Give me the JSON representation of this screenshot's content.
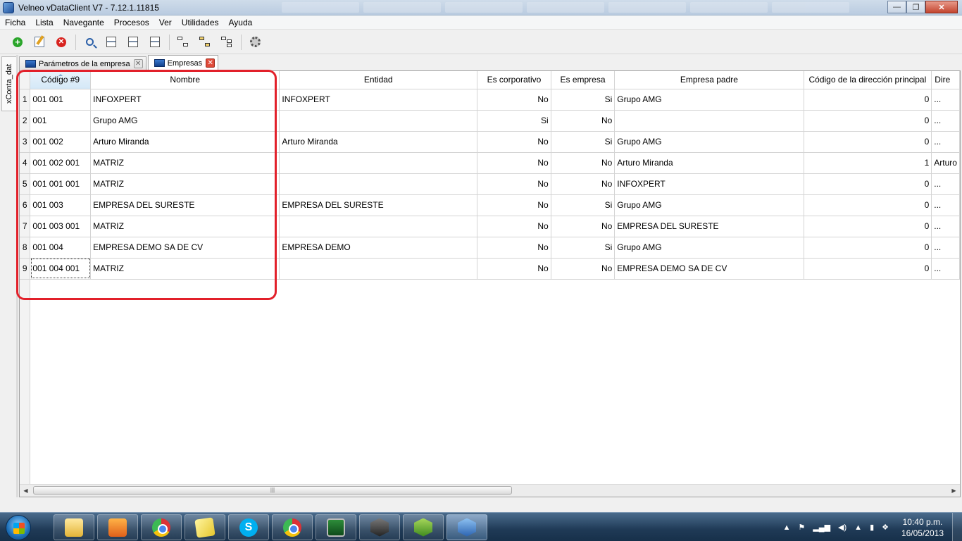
{
  "window": {
    "title": "Velneo vDataClient V7 - 7.12.1.11815"
  },
  "menu": [
    "Ficha",
    "Lista",
    "Navegante",
    "Procesos",
    "Ver",
    "Utilidades",
    "Ayuda"
  ],
  "toolbar": {
    "buttons": [
      "add-icon",
      "edit-icon",
      "delete-icon",
      "search-icon",
      "form-icon",
      "list-icon",
      "grid-icon",
      "tree-icon",
      "tree-folder-icon",
      "tree-branch-icon",
      "settings-icon"
    ]
  },
  "sidebar": {
    "tab_label": "xConta_dat"
  },
  "tabs": [
    {
      "label": "Parámetros de la empresa",
      "active": false
    },
    {
      "label": "Empresas",
      "active": true
    }
  ],
  "grid": {
    "columns": [
      "Código #9",
      "Nombre",
      "Entidad",
      "Es corporativo",
      "Es empresa",
      "Empresa padre",
      "Código de la dirección principal",
      "Dire"
    ],
    "rows": [
      {
        "n": "1",
        "codigo": "001 001",
        "nombre": "INFOXPERT",
        "entidad": "INFOXPERT",
        "corp": "No",
        "empresa": "Si",
        "padre": "Grupo AMG",
        "cod_dir": "0",
        "dir": "..."
      },
      {
        "n": "2",
        "codigo": "001",
        "nombre": "Grupo AMG",
        "entidad": "",
        "corp": "Si",
        "empresa": "No",
        "padre": "",
        "cod_dir": "0",
        "dir": "..."
      },
      {
        "n": "3",
        "codigo": "001 002",
        "nombre": "Arturo Miranda",
        "entidad": "Arturo Miranda",
        "corp": "No",
        "empresa": "Si",
        "padre": "Grupo AMG",
        "cod_dir": "0",
        "dir": "..."
      },
      {
        "n": "4",
        "codigo": "001 002 001",
        "nombre": "MATRIZ",
        "entidad": "",
        "corp": "No",
        "empresa": "No",
        "padre": "Arturo Miranda",
        "cod_dir": "1",
        "dir": "Arturo"
      },
      {
        "n": "5",
        "codigo": "001 001 001",
        "nombre": "MATRIZ",
        "entidad": "",
        "corp": "No",
        "empresa": "No",
        "padre": "INFOXPERT",
        "cod_dir": "0",
        "dir": "..."
      },
      {
        "n": "6",
        "codigo": "001 003",
        "nombre": "EMPRESA DEL SURESTE",
        "entidad": "EMPRESA DEL SURESTE",
        "corp": "No",
        "empresa": "Si",
        "padre": "Grupo AMG",
        "cod_dir": "0",
        "dir": "..."
      },
      {
        "n": "7",
        "codigo": "001 003 001",
        "nombre": "MATRIZ",
        "entidad": "",
        "corp": "No",
        "empresa": "No",
        "padre": "EMPRESA DEL SURESTE",
        "cod_dir": "0",
        "dir": "..."
      },
      {
        "n": "8",
        "codigo": "001 004",
        "nombre": "EMPRESA DEMO SA DE CV",
        "entidad": "EMPRESA DEMO",
        "corp": "No",
        "empresa": "Si",
        "padre": "Grupo AMG",
        "cod_dir": "0",
        "dir": "..."
      },
      {
        "n": "9",
        "codigo": "001 004 001",
        "nombre": "MATRIZ",
        "entidad": "",
        "corp": "No",
        "empresa": "No",
        "padre": "EMPRESA DEMO SA DE CV",
        "cod_dir": "0",
        "dir": "..."
      }
    ]
  },
  "taskbar": {
    "apps": [
      "folder-icon",
      "media-player-icon",
      "chrome-icon",
      "sticky-notes-icon",
      "skype-icon",
      "chrome-icon",
      "monitor-icon",
      "velneo-dark-icon",
      "velneo-green-icon",
      "velneo-blue-icon"
    ],
    "clock_time": "10:40 p.m.",
    "clock_date": "16/05/2013"
  },
  "colors": {
    "highlight": "#e2202a",
    "sorted_header": "#d4e8f7",
    "taskbar": "#1f3a56"
  }
}
